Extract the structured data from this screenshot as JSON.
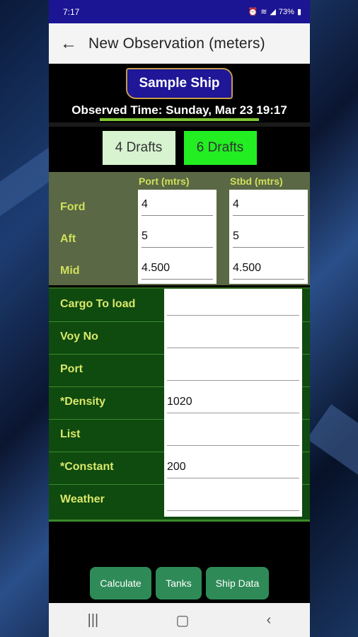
{
  "status": {
    "time": "7:17",
    "battery": "73%",
    "alarm_icon": "alarm-icon",
    "wifi_icon": "wifi-icon",
    "signal_icon": "signal-icon"
  },
  "appbar": {
    "back_icon": "arrow-back-icon",
    "title": "New Observation (meters)"
  },
  "ship": {
    "name": "Sample Ship"
  },
  "observed_time": "Observed Time: Sunday, Mar 23 19:17",
  "toggles": {
    "four": "4 Drafts",
    "six": "6 Drafts",
    "selected": "6 Drafts"
  },
  "drafts": {
    "port_header": "Port (mtrs)",
    "stbd_header": "Stbd (mtrs)",
    "labels": {
      "ford": "Ford",
      "aft": "Aft",
      "mid": "Mid"
    },
    "port": {
      "ford": "4",
      "aft": "5",
      "mid": "4.500"
    },
    "stbd": {
      "ford": "4",
      "aft": "5",
      "mid": "4.500"
    }
  },
  "fields": [
    {
      "label": "Cargo To load",
      "value": ""
    },
    {
      "label": "Voy No",
      "value": ""
    },
    {
      "label": "Port",
      "value": ""
    },
    {
      "label": "*Density",
      "value": "1020"
    },
    {
      "label": "List",
      "value": ""
    },
    {
      "label": "*Constant",
      "value": "200"
    },
    {
      "label": "Weather",
      "value": ""
    }
  ],
  "buttons": {
    "calculate": "Calculate",
    "tanks": "Tanks",
    "ship_data": "Ship Data"
  },
  "navbar": {
    "recents": "recents-icon",
    "home": "home-icon",
    "back": "back-icon"
  },
  "colors": {
    "status_bar": "#1b1593",
    "accent_green": "#22ee22",
    "button_green": "#2e8b57",
    "label_yellow": "#d9e86a"
  }
}
